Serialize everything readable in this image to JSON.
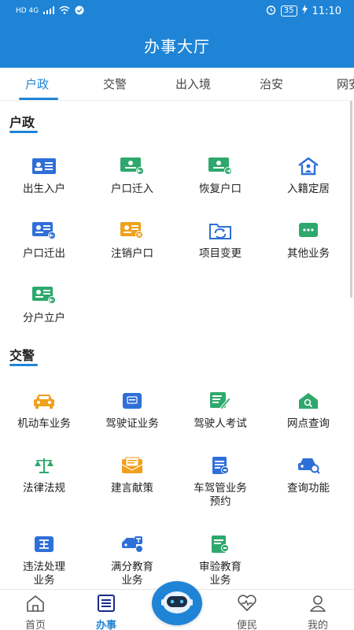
{
  "statusbar": {
    "left_label": "HD 4G",
    "battery": "35",
    "time": "11:10"
  },
  "appbar": {
    "title": "办事大厅"
  },
  "tabs": [
    {
      "label": "户政",
      "active": true
    },
    {
      "label": "交警",
      "active": false
    },
    {
      "label": "出入境",
      "active": false
    },
    {
      "label": "治安",
      "active": false
    },
    {
      "label": "网安",
      "active": false
    }
  ],
  "sections": [
    {
      "title": "户政",
      "items": [
        {
          "label": "出生入户",
          "icon": "id-card-icon"
        },
        {
          "label": "户口迁入",
          "icon": "household-in-icon"
        },
        {
          "label": "恢复户口",
          "icon": "household-restore-icon"
        },
        {
          "label": "入籍定居",
          "icon": "house-person-icon"
        },
        {
          "label": "户口迁出",
          "icon": "household-out-icon"
        },
        {
          "label": "注销户口",
          "icon": "household-cancel-icon"
        },
        {
          "label": "项目变更",
          "icon": "folder-change-icon"
        },
        {
          "label": "其他业务",
          "icon": "chat-bubble-icon"
        },
        {
          "label": "分户立户",
          "icon": "household-split-icon"
        }
      ]
    },
    {
      "title": "交警",
      "items": [
        {
          "label": "机动车业务",
          "icon": "car-icon"
        },
        {
          "label": "驾驶证业务",
          "icon": "license-icon"
        },
        {
          "label": "驾驶人考试",
          "icon": "exam-edit-icon"
        },
        {
          "label": "网点查询",
          "icon": "branch-search-icon"
        },
        {
          "label": "法律法规",
          "icon": "scales-icon"
        },
        {
          "label": "建言献策",
          "icon": "mail-icon"
        },
        {
          "label": "车驾管业务预约",
          "icon": "appointment-icon"
        },
        {
          "label": "查询功能",
          "icon": "car-search-icon"
        },
        {
          "label": "违法处理业务",
          "icon": "violation-icon"
        },
        {
          "label": "满分教育业务",
          "icon": "education-icon"
        },
        {
          "label": "审验教育业务",
          "icon": "review-doc-icon"
        }
      ]
    }
  ],
  "bottom_nav": [
    {
      "label": "首页",
      "icon": "home-icon",
      "active": false
    },
    {
      "label": "办事",
      "icon": "list-icon",
      "active": true
    },
    {
      "label": "便民",
      "icon": "heart-icon",
      "active": false
    },
    {
      "label": "我的",
      "icon": "user-icon",
      "active": false
    }
  ],
  "colors": {
    "brand": "#1f84d6",
    "green": "#2ea86c",
    "orange": "#f0a019",
    "blue": "#2f6fd8"
  }
}
